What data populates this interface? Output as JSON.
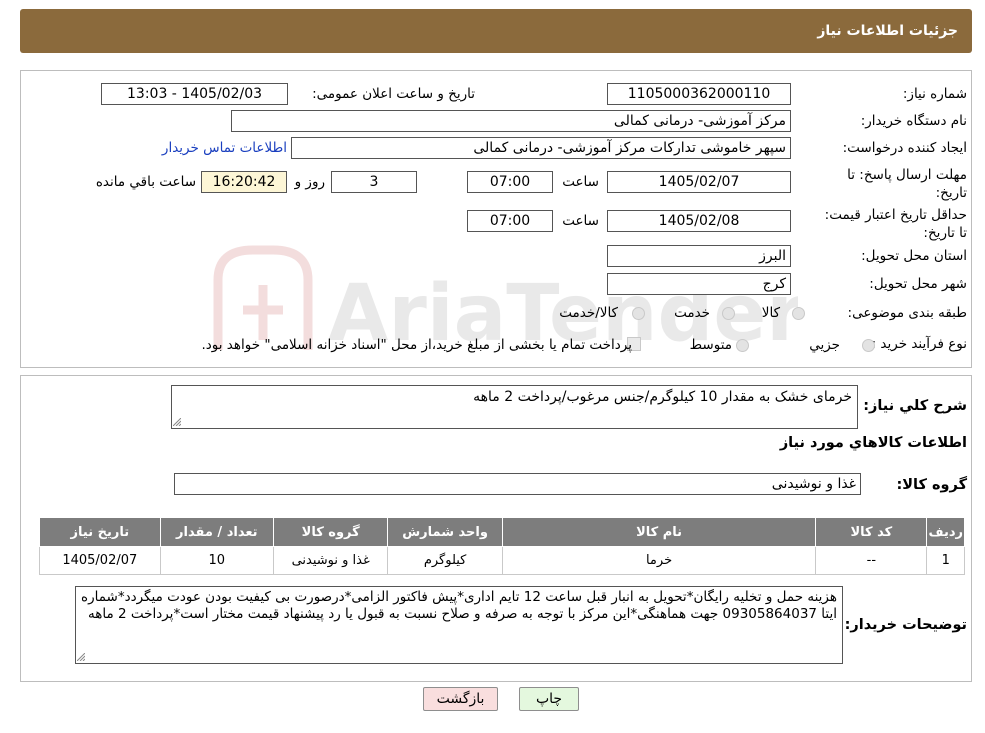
{
  "header": {
    "title": "جزئیات اطلاعات نیاز"
  },
  "form": {
    "need_number": {
      "label": "شماره نیاز:",
      "value": "1105000362000110"
    },
    "announce_datetime": {
      "label": "تاریخ و ساعت اعلان عمومی:",
      "value": "1405/02/03 - 13:03"
    },
    "buyer_org": {
      "label": "نام دستگاه خریدار:",
      "value": "مرکز آموزشی- درمانی کمالی"
    },
    "requester": {
      "label": "ایجاد کننده درخواست:",
      "value": "سپهر خاموشی تدارکات مرکز آموزشی- درمانی کمالی",
      "contact_link": "اطلاعات تماس خریدار"
    },
    "reply_deadline": {
      "label": "مهلت ارسال پاسخ: تا تاریخ:",
      "date": "1405/02/07",
      "time_label": "ساعت",
      "time": "07:00",
      "days": "3",
      "days_label": "روز و",
      "remaining": "16:20:42",
      "remaining_label": "ساعت باقي مانده"
    },
    "price_validity": {
      "label": "حداقل تاریخ اعتبار قیمت: تا تاریخ:",
      "date": "1405/02/08",
      "time_label": "ساعت",
      "time": "07:00"
    },
    "province": {
      "label": "استان محل تحویل:",
      "value": "البرز"
    },
    "city": {
      "label": "شهر محل تحویل:",
      "value": "کرج"
    },
    "category": {
      "label": "طبقه بندی موضوعی:",
      "options": [
        "کالا",
        "خدمت",
        "کالا/خدمت"
      ]
    },
    "purchase_type": {
      "label": "نوع فرآیند خرید :",
      "options": [
        "جزیي",
        "متوسط"
      ],
      "note": "پرداخت تمام یا بخشی از مبلغ خرید،از محل \"اسناد خزانه اسلامی\" خواهد بود."
    }
  },
  "details": {
    "summary_label": "شرح کلي نياز:",
    "summary_value": "خرمای خشک به مقدار 10 کیلوگرم/جنس مرغوب/پرداخت 2 ماهه",
    "goods_section_title": "اطلاعات کالاهاي مورد نياز",
    "goods_group_label": "گروه کالا:",
    "goods_group_value": "غذا و نوشیدنی",
    "table": {
      "headers": [
        "رديف",
        "کد کالا",
        "نام کالا",
        "واحد شمارش",
        "گروه کالا",
        "تعداد / مقدار",
        "تاريخ نياز"
      ],
      "rows": [
        [
          "1",
          "--",
          "خرما",
          "کیلوگرم",
          "غذا و نوشیدنی",
          "10",
          "1405/02/07"
        ]
      ]
    },
    "buyer_notes_label": "توضیحات خریدار:",
    "buyer_notes_value": "هزینه حمل و تخلیه رایگان*تحویل به انبار قبل ساعت 12 تایم اداری*پیش فاکتور الزامی*درصورت بی کیفیت بودن عودت میگردد*شماره ایتا 09305864037 جهت هماهنگی*این مرکز با توجه به صرفه و صلاح نسبت به قبول یا رد پیشنهاد قیمت مختار است*پرداخت 2 ماهه"
  },
  "buttons": {
    "print": "چاپ",
    "back": "بازگشت"
  },
  "watermark": {
    "text": "AriaTender.neT"
  },
  "colors": {
    "header_bg": "#8b6a3c",
    "table_header_bg": "#7d7d7d",
    "link": "#1a3fbf",
    "remaining_bg": "#fdf6d6",
    "back_btn_bg": "#f9dede",
    "print_btn_bg": "#e4f8de"
  }
}
